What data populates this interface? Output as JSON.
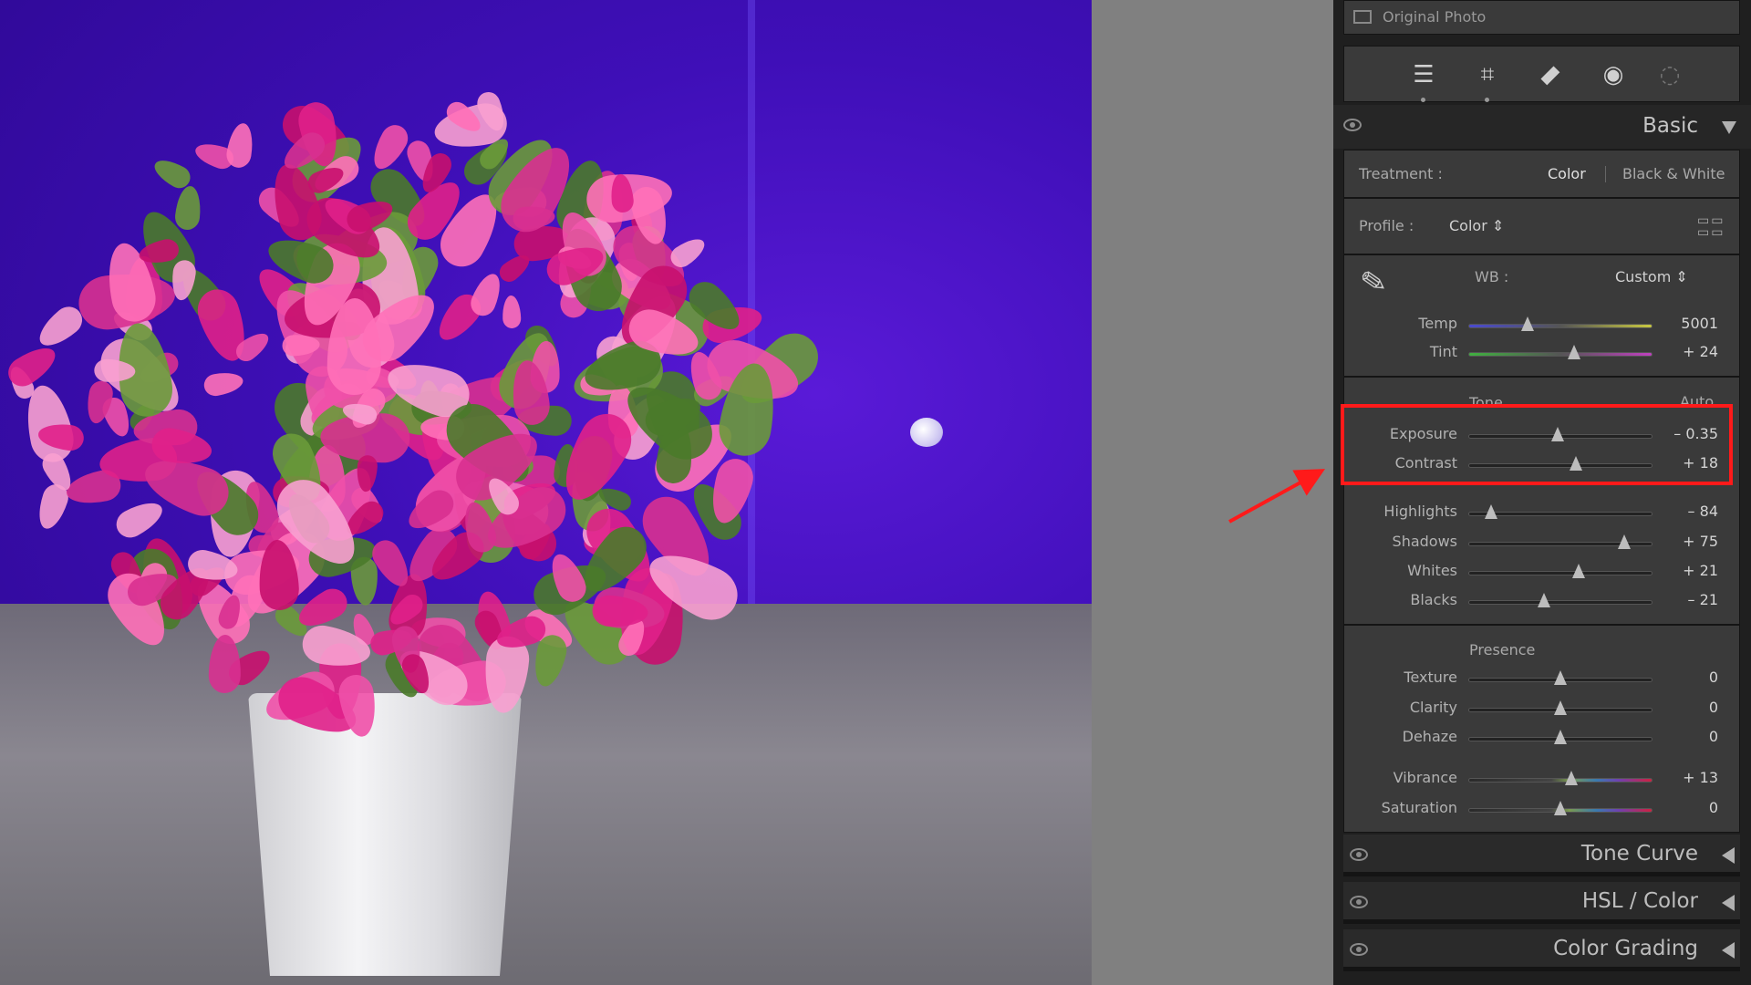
{
  "original_photo": {
    "label": "Original Photo",
    "checked": false
  },
  "tools": [
    {
      "name": "edit-sliders-icon"
    },
    {
      "name": "crop-icon"
    },
    {
      "name": "healing-icon"
    },
    {
      "name": "red-eye-icon"
    },
    {
      "name": "masking-icon"
    }
  ],
  "basic": {
    "title": "Basic",
    "treatment": {
      "label": "Treatment :",
      "color": "Color",
      "bw": "Black & White",
      "selected": "Color"
    },
    "profile": {
      "label": "Profile :",
      "value": "Color"
    },
    "wb": {
      "label": "WB :",
      "value": "Custom"
    },
    "wb_sliders": [
      {
        "name": "Temp",
        "value": "5001",
        "level": 0.32,
        "gradient": [
          "#4a4ad0",
          "#c8c840"
        ]
      },
      {
        "name": "Tint",
        "value": "+ 24",
        "level": 0.577,
        "gradient": [
          "#40b040",
          "#c040c0"
        ]
      }
    ],
    "tone": {
      "label": "Tone",
      "auto": "Auto"
    },
    "tone_sliders": [
      {
        "name": "Exposure",
        "value": "– 0.35",
        "level": 0.486
      },
      {
        "name": "Contrast",
        "value": "+ 18",
        "level": 0.585
      },
      {
        "name": "Highlights",
        "value": "– 84",
        "level": 0.12
      },
      {
        "name": "Shadows",
        "value": "+ 75",
        "level": 0.85
      },
      {
        "name": "Whites",
        "value": "+ 21",
        "level": 0.6
      },
      {
        "name": "Blacks",
        "value": "– 21",
        "level": 0.41
      }
    ],
    "presence": {
      "label": "Presence"
    },
    "presence_sliders": [
      {
        "name": "Texture",
        "value": "0",
        "level": 0.5
      },
      {
        "name": "Clarity",
        "value": "0",
        "level": 0.5
      },
      {
        "name": "Dehaze",
        "value": "0",
        "level": 0.5
      },
      {
        "name": "Vibrance",
        "value": "+ 13",
        "level": 0.56,
        "colorful": true
      },
      {
        "name": "Saturation",
        "value": "0",
        "level": 0.5,
        "colorful": true
      }
    ]
  },
  "sections": [
    {
      "title": "Tone Curve"
    },
    {
      "title": "HSL / Color"
    },
    {
      "title": "Color Grading"
    }
  ],
  "annotation": {
    "highlight_color": "#ff1a1a",
    "highlights": [
      "Exposure",
      "Contrast"
    ]
  }
}
